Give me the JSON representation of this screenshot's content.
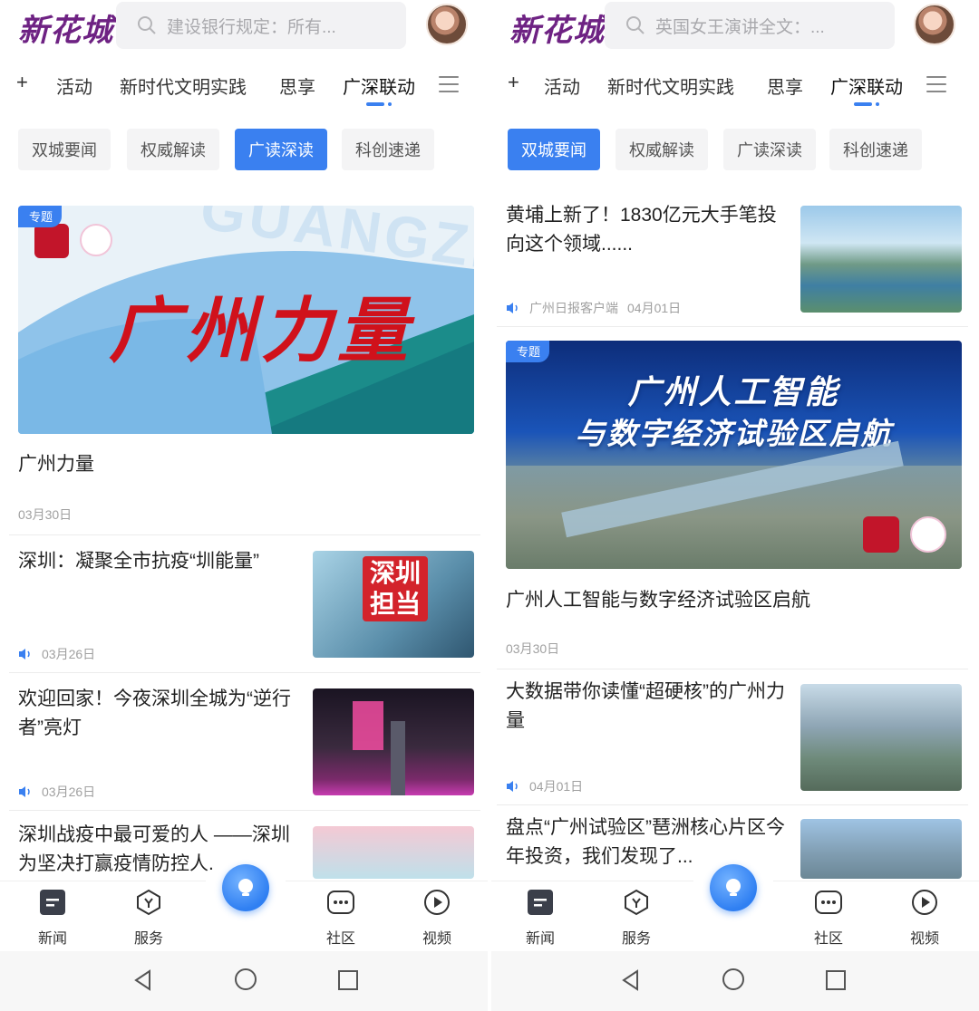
{
  "left": {
    "app_logo": "新花城",
    "search_placeholder": "建设银行规定：所有...",
    "tabs": [
      "+",
      "活动",
      "新时代文明实践",
      "思享",
      "广深联动"
    ],
    "subtabs": [
      "双城要闻",
      "权威解读",
      "广读深读",
      "科创速递"
    ],
    "active_subtab": "广读深读",
    "feature": {
      "tag": "专题",
      "banner_text": "广州力量",
      "banner_bg_text": "GUANGZHO",
      "title": "广州力量",
      "date": "03月30日"
    },
    "items": [
      {
        "title": "深圳：凝聚全市抗疫“圳能量”",
        "date": "03月26日",
        "img_text_1": "深圳",
        "img_text_2": "担当"
      },
      {
        "title": "欢迎回家！今夜深圳全城为“逆行者”亮灯",
        "date": "03月26日"
      },
      {
        "title": "深圳战疫中最可爱的人 ——深圳为坚决打赢疫情防控人...",
        "date": ""
      }
    ]
  },
  "right": {
    "app_logo": "新花城",
    "search_placeholder": "英国女王演讲全文：...",
    "tabs": [
      "+",
      "活动",
      "新时代文明实践",
      "思享",
      "广深联动"
    ],
    "subtabs": [
      "双城要闻",
      "权威解读",
      "广读深读",
      "科创速递"
    ],
    "active_subtab": "双城要闻",
    "items_top": [
      {
        "title": "黄埔上新了！1830亿元大手笔投向这个领域......",
        "source": "广州日报客户端",
        "date": "04月01日"
      }
    ],
    "feature": {
      "tag": "专题",
      "banner_line1": "广州人工智能",
      "banner_line2": "与数字经济试验区启航",
      "title": "广州人工智能与数字经济试验区启航",
      "date": "03月30日"
    },
    "items": [
      {
        "title": "大数据带你读懂“超硬核”的广州力量",
        "date": "04月01日"
      },
      {
        "title": "盘点“广州试验区”琶洲核心片区今年投资，我们发现了...",
        "date": ""
      }
    ]
  },
  "bottom_nav": [
    {
      "label": "新闻",
      "icon": "news-icon"
    },
    {
      "label": "服务",
      "icon": "service-icon"
    },
    {
      "label": "社区",
      "icon": "community-icon"
    },
    {
      "label": "视频",
      "icon": "video-icon"
    }
  ],
  "colors": {
    "accent": "#3a80f0",
    "logo": "#6e2283"
  }
}
